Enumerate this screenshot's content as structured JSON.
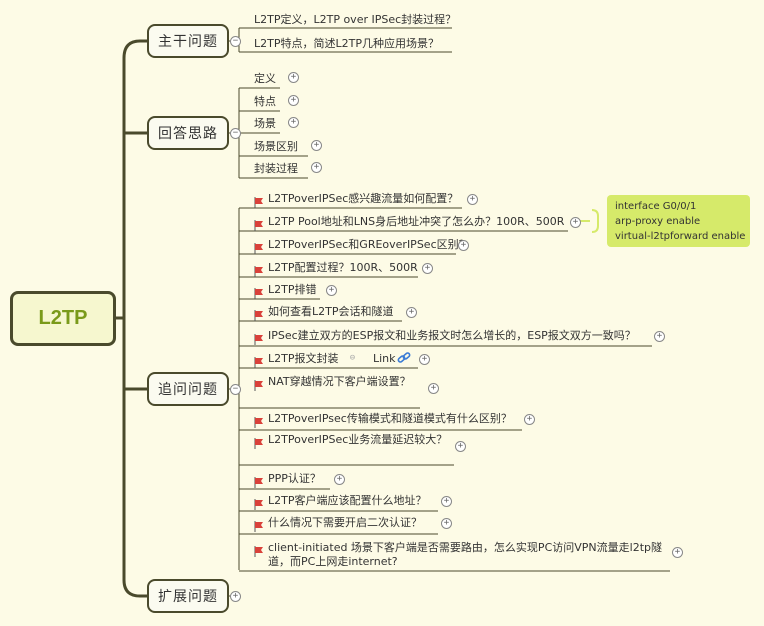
{
  "root": {
    "label": "L2TP"
  },
  "branches": [
    {
      "label": "主干问题"
    },
    {
      "label": "回答思路"
    },
    {
      "label": "追问问题"
    },
    {
      "label": "扩展问题"
    }
  ],
  "trunk_items": [
    "L2TP定义，L2TP over IPSec封装过程？",
    "L2TP特点，简述L2TP几种应用场景？"
  ],
  "answer_items": [
    "定义",
    "特点",
    "场景",
    "场景区别",
    "封装过程"
  ],
  "follow_items": [
    "L2TPoverIPSec感兴趣流量如何配置？",
    "L2TP Pool地址和LNS身后地址冲突了怎么办？100R、500R",
    "L2TPoverIPSec和GREoverIPSec区别？",
    "L2TP配置过程？100R、500R",
    "L2TP排错",
    "如何查看L2TP会话和隧道",
    "IPSec建立双方的ESP报文和业务报文时怎么增长的，ESP报文双方一致吗？",
    "L2TP报文封装",
    "NAT穿越情况下客户端设置？",
    "L2TPoverIPsec传输模式和隧道模式有什么区别？",
    "L2TPoverIPSec业务流量延迟较大？",
    "PPP认证？",
    "L2TP客户端应该配置什么地址？",
    "什么情况下需要开启二次认证？",
    "client-initiated 场景下客户端是否需要路由，怎么实现PC访问VPN流量走l2tp隧道，而PC上网走internet?"
  ],
  "link_label": "Link",
  "note_lines": [
    "interface G0/0/1",
    "arp-proxy enable",
    "virtual-l2tpforward enable"
  ],
  "colors": {
    "line": "#4a4a2c",
    "flag": "#d9413a",
    "note_bg": "#d6ea6a",
    "root_text": "#7a9a1a"
  }
}
